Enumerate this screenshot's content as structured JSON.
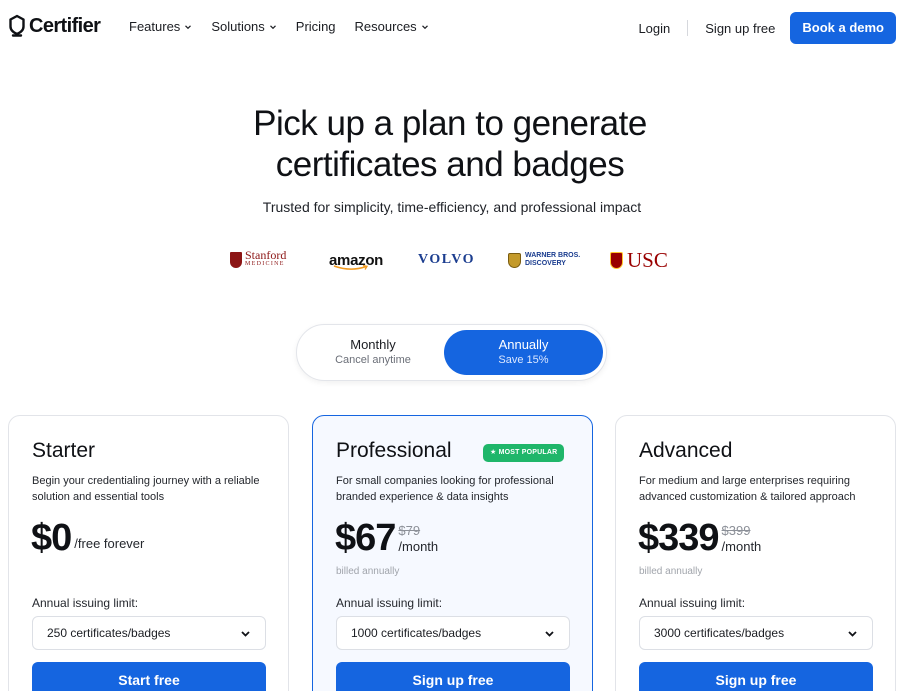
{
  "brand": {
    "name": "Certifier",
    "accent": "#1565e0"
  },
  "nav": {
    "menu": [
      {
        "label": "Features",
        "dropdown": true
      },
      {
        "label": "Solutions",
        "dropdown": true
      },
      {
        "label": "Pricing",
        "dropdown": false
      },
      {
        "label": "Resources",
        "dropdown": true
      }
    ],
    "login": "Login",
    "signup": "Sign up free",
    "demo": "Book a demo"
  },
  "hero": {
    "title_line1": "Pick up a plan to generate",
    "title_line2": "certificates and badges",
    "subtitle": "Trusted for simplicity, time-efficiency, and professional impact"
  },
  "logos": {
    "stanford_a": "Stanford",
    "stanford_b": "MEDICINE",
    "amazon": "amazon",
    "volvo": "VOLVO",
    "wb_a": "WARNER BROS.",
    "wb_b": "DISCOVERY",
    "usc": "USC"
  },
  "billing_toggle": {
    "monthly": {
      "label": "Monthly",
      "sub": "Cancel anytime"
    },
    "annually": {
      "label": "Annually",
      "sub": "Save 15%"
    },
    "selected": "annually"
  },
  "plans": [
    {
      "name": "Starter",
      "badge": "",
      "description": "Begin your credentialing journey with a reliable solution and essential tools",
      "price": "$0",
      "old_price": "",
      "per": "/free forever",
      "billed": "",
      "limit_label": "Annual issuing limit:",
      "limit_value": "250 certificates/badges",
      "cta": "Start free"
    },
    {
      "name": "Professional",
      "badge": "MOST POPULAR",
      "description": "For small companies looking for professional branded experience & data insights",
      "price": "$67",
      "old_price": "$79",
      "per": "/month",
      "billed": "billed annually",
      "limit_label": "Annual issuing limit:",
      "limit_value": "1000 certificates/badges",
      "cta": "Sign up free"
    },
    {
      "name": "Advanced",
      "badge": "",
      "description": "For medium and large enterprises requiring advanced customization & tailored approach",
      "price": "$339",
      "old_price": "$399",
      "per": "/month",
      "billed": "billed annually",
      "limit_label": "Annual issuing limit:",
      "limit_value": "3000 certificates/badges",
      "cta": "Sign up free"
    }
  ]
}
